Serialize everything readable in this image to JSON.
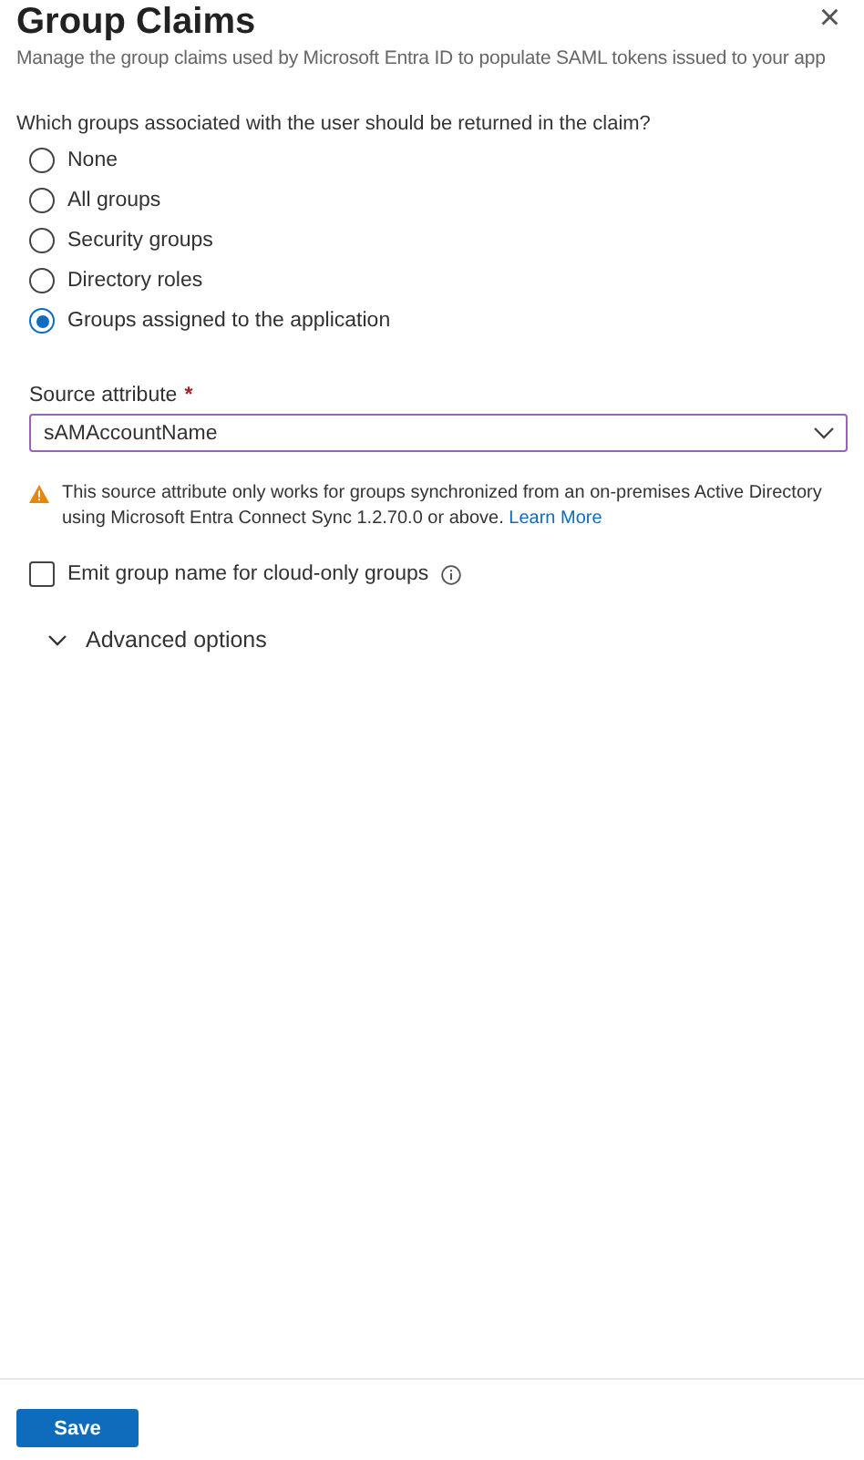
{
  "panel": {
    "title": "Group Claims",
    "subtitle": "Manage the group claims used by Microsoft Entra ID to populate SAML tokens issued to your app",
    "close": "×"
  },
  "question": "Which groups associated with the user should be returned in the claim?",
  "options": [
    {
      "label": "None",
      "selected": false
    },
    {
      "label": "All groups",
      "selected": false
    },
    {
      "label": "Security groups",
      "selected": false
    },
    {
      "label": "Directory roles",
      "selected": false
    },
    {
      "label": "Groups assigned to the application",
      "selected": true
    }
  ],
  "source_attribute": {
    "label": "Source attribute",
    "required_mark": "*",
    "value": "sAMAccountName"
  },
  "warning": {
    "text": "This source attribute only works for groups synchronized from an on-premises Active Directory using Microsoft Entra Connect Sync 1.2.70.0 or above.",
    "link": "Learn More"
  },
  "emit_checkbox": {
    "label": "Emit group name for cloud-only groups",
    "checked": false
  },
  "advanced": {
    "label": "Advanced options",
    "expanded": false
  },
  "buttons": [
    {
      "label": "Save",
      "kind": "primary"
    }
  ]
}
